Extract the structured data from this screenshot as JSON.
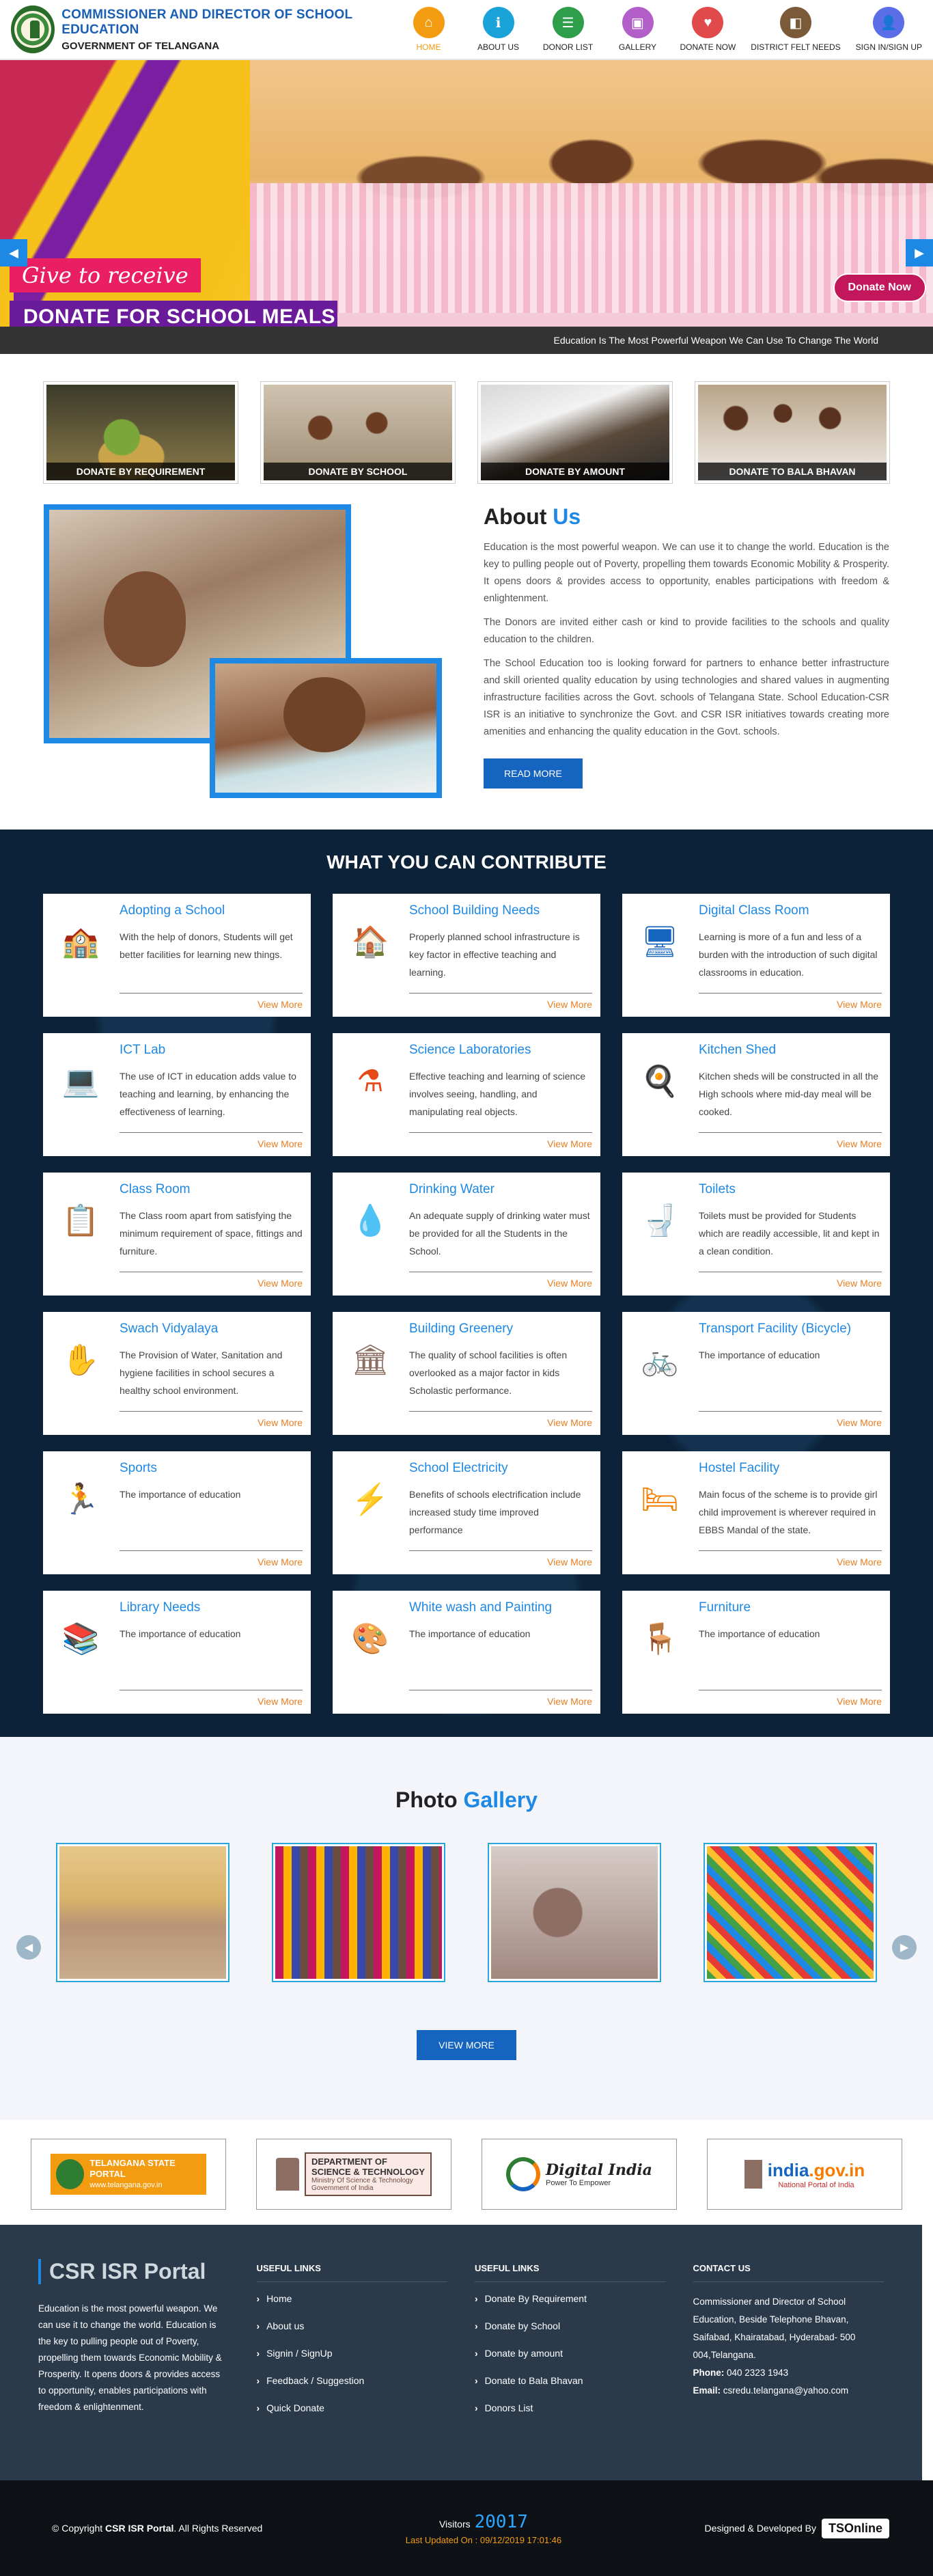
{
  "header": {
    "title": "COMMISSIONER AND DIRECTOR OF SCHOOL EDUCATION",
    "subtitle": "GOVERNMENT OF TELANGANA",
    "nav": [
      {
        "label": "HOME",
        "icon": "home-icon",
        "color": "#f39c12"
      },
      {
        "label": "ABOUT US",
        "icon": "info-icon",
        "color": "#1aa3d9"
      },
      {
        "label": "DONOR LIST",
        "icon": "list-icon",
        "color": "#2e9e4b"
      },
      {
        "label": "GALLERY",
        "icon": "image-icon",
        "color": "#b35fc9"
      },
      {
        "label": "DONATE NOW",
        "icon": "donate-icon",
        "color": "#e04a4a"
      },
      {
        "label": "DISTRICT FELT NEEDS",
        "icon": "district-icon",
        "color": "#7b5a3a"
      },
      {
        "label": "SIGN IN/SIGN UP",
        "icon": "user-icon",
        "color": "#5b6ee8"
      }
    ]
  },
  "hero": {
    "tagline": "Give to receive",
    "banner": "DONATE FOR SCHOOL MEALS",
    "donate_now": "Donate Now",
    "marquee": "Education Is The Most Powerful Weapon We Can Use To Change The World"
  },
  "tiles": [
    {
      "label": "DONATE BY REQUIREMENT"
    },
    {
      "label": "DONATE BY SCHOOL"
    },
    {
      "label": "DONATE BY AMOUNT"
    },
    {
      "label": "DONATE TO BALA BHAVAN"
    }
  ],
  "about": {
    "title_a": "About",
    "title_b": "Us",
    "p1": "Education is the most powerful weapon. We can use it to change the world. Education is the key to pulling people out of Poverty, propelling them towards Economic Mobility & Prosperity. It opens doors & provides access to opportunity, enables participations with freedom & enlightenment.",
    "p2": "The Donors are invited either cash or kind to provide facilities to the schools and quality education to the children.",
    "p3": "The School Education too is looking forward for partners to enhance better infrastructure and skill oriented quality education by using technologies and shared values in augmenting infrastructure facilities across the Govt. schools of Telangana State. School Education-CSR ISR is an initiative to synchronize the Govt. and CSR ISR initiatives towards creating more amenities and enhancing the quality education in the Govt. schools.",
    "read_more": "READ MORE"
  },
  "contribute": {
    "title": "WHAT YOU CAN CONTRIBUTE",
    "view_more": "View More",
    "cards": [
      {
        "title": "Adopting a School",
        "desc": "With the help of donors, Students will get better facilities for learning new things.",
        "icon": "school-building-icon"
      },
      {
        "title": "School Building Needs",
        "desc": "Properly planned school infrastructure is key factor in effective teaching and learning.",
        "icon": "school-house-icon"
      },
      {
        "title": "Digital Class Room",
        "desc": "Learning is more of a fun and less of a burden with the introduction of such digital classrooms in education.",
        "icon": "digital-board-icon"
      },
      {
        "title": "ICT Lab",
        "desc": "The use of ICT in education adds value to teaching and learning, by enhancing the effectiveness of learning.",
        "icon": "computer-lab-icon"
      },
      {
        "title": "Science Laboratories",
        "desc": "Effective teaching and learning of science involves seeing, handling, and manipulating real objects.",
        "icon": "flask-icon"
      },
      {
        "title": "Kitchen Shed",
        "desc": "Kitchen sheds will be constructed in all the High schools where mid-day meal will be cooked.",
        "icon": "kitchen-icon"
      },
      {
        "title": "Class Room",
        "desc": "The Class room apart from satisfying the minimum requirement of space, fittings and furniture.",
        "icon": "teacher-icon"
      },
      {
        "title": "Drinking Water",
        "desc": "An adequate supply of drinking water must be provided for all the Students in the School.",
        "icon": "water-drop-icon"
      },
      {
        "title": "Toilets",
        "desc": "Toilets must be provided for Students which are readily accessible, lit and kept in a clean condition.",
        "icon": "toilet-icon"
      },
      {
        "title": "Swach Vidyalaya",
        "desc": "The Provision of Water, Sanitation and hygiene facilities in school secures a healthy school environment.",
        "icon": "clean-hand-icon"
      },
      {
        "title": "Building Greenery",
        "desc": "The quality of school facilities is often overlooked as a major factor in kids Scholastic performance.",
        "icon": "green-building-icon"
      },
      {
        "title": "Transport Facility (Bicycle)",
        "desc": "The importance of education",
        "icon": "bicycle-icon"
      },
      {
        "title": "Sports",
        "desc": "The importance of education",
        "icon": "running-icon"
      },
      {
        "title": "School Electricity",
        "desc": "Benefits of schools electrification include increased study time improved performance",
        "icon": "electricity-icon"
      },
      {
        "title": "Hostel Facility",
        "desc": "Main focus of the scheme is to provide girl child improvement is wherever required in EBBS Mandal of the state.",
        "icon": "bed-icon"
      },
      {
        "title": "Library Needs",
        "desc": "The importance of education",
        "icon": "books-icon"
      },
      {
        "title": "White wash and Painting",
        "desc": "The importance of education",
        "icon": "palette-icon"
      },
      {
        "title": "Furniture",
        "desc": "The importance of education",
        "icon": "chair-icon"
      }
    ]
  },
  "gallery": {
    "title_a": "Photo",
    "title_b": "Gallery",
    "view_more": "VIEW MORE"
  },
  "partners": {
    "ts_a": "TELANGANA STATE PORTAL",
    "ts_b": "www.telangana.gov.in",
    "dst_a": "DEPARTMENT OF",
    "dst_b": "SCIENCE & TECHNOLOGY",
    "dst_c": "Ministry Of Science & Technology",
    "dst_d": "Government of India",
    "di_a": "Digital India",
    "di_b": "Power To Empower",
    "in_a": "india",
    "in_b": ".gov.in",
    "in_c": "National Portal of India"
  },
  "footer": {
    "brand": "CSR ISR Portal",
    "about": "Education is the most powerful weapon. We can use it to change the world. Education is the key to pulling people out of Poverty, propelling them towards Economic Mobility & Prosperity. It opens doors & provides access to opportunity, enables participations with freedom & enlightenment.",
    "useful1_head": "USEFUL LINKS",
    "useful1": [
      "Home",
      "About us",
      "Signin / SignUp",
      "Feedback / Suggestion",
      "Quick Donate"
    ],
    "useful2_head": "USEFUL LINKS",
    "useful2": [
      "Donate By Requirement",
      "Donate by School",
      "Donate by amount",
      "Donate to Bala Bhavan",
      "Donors List"
    ],
    "contact_head": "CONTACT US",
    "address": "Commissioner and Director of School Education, Beside Telephone Bhavan, Saifabad, Khairatabad, Hyderabad- 500 004,Telangana.",
    "phone_label": "Phone:",
    "phone": "040 2323 1943",
    "email_label": "Email:",
    "email": "csredu.telangana@yahoo.com"
  },
  "bottom": {
    "copy_a": "© Copyright",
    "copy_b": "CSR ISR Portal",
    "copy_c": ". All Rights Reserved",
    "visitors_label": "Visitors",
    "visitors": "20017",
    "last_updated": "Last Updated On : 09/12/2019 17:01:46",
    "designed": "Designed & Developed By",
    "developer": "TSOnline"
  }
}
